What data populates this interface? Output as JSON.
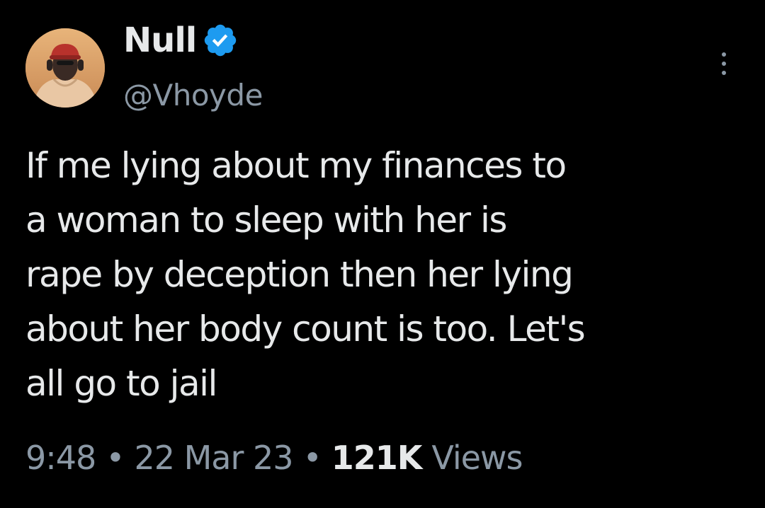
{
  "tweet": {
    "author": {
      "display_name": "Null",
      "handle": "@Vhoyde",
      "verified": true,
      "avatar_icon": "profile-photo"
    },
    "more_icon": "more-options-icon",
    "text": "If me lying about my finances to\na woman to sleep with her is\nrape by deception then her lying\nabout her body count is too. Let's\nall go to jail",
    "meta": {
      "time": "9:48",
      "separator": "•",
      "date": "22 Mar 23",
      "views_count": "121K",
      "views_label": "Views"
    }
  },
  "colors": {
    "background": "#000000",
    "primary_text": "#e7e9ea",
    "secondary_text": "#8b98a5",
    "verified_blue": "#1d9bf0"
  }
}
